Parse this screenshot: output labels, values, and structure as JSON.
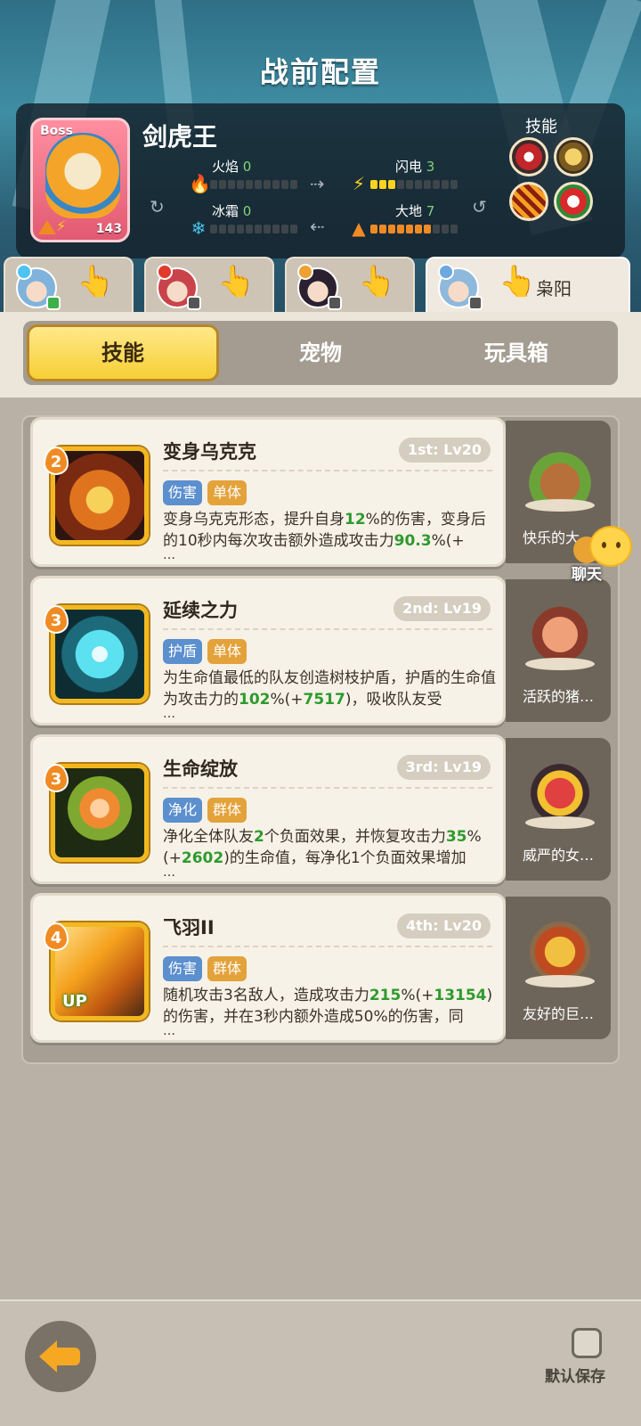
{
  "header": {
    "title": "战前配置"
  },
  "boss": {
    "tag": "Boss",
    "name": "剑虎王",
    "level": "143",
    "elements": [
      {
        "label": "火焰",
        "value": "0",
        "icon": "fire-icon",
        "filled": 0,
        "color": "#e23b2b"
      },
      {
        "label": "闪电",
        "value": "3",
        "icon": "lightning-icon",
        "filled": 3,
        "color": "#ffd21f"
      },
      {
        "label": "冰霜",
        "value": "0",
        "icon": "snowflake-icon",
        "filled": 0,
        "color": "#4cc3f0"
      },
      {
        "label": "大地",
        "value": "7",
        "icon": "mountain-icon",
        "filled": 7,
        "color": "#f08b24"
      }
    ],
    "skills_label": "技能",
    "skill_icons": [
      "boss-skill-bite-icon",
      "boss-skill-roar-icon",
      "boss-skill-slash-icon",
      "boss-skill-claw-icon"
    ]
  },
  "heroes": [
    {
      "name": "",
      "active": false,
      "badge": "green"
    },
    {
      "name": "",
      "active": false,
      "badge": "gray"
    },
    {
      "name": "",
      "active": false,
      "badge": "gray"
    },
    {
      "name": "枭阳",
      "active": true,
      "badge": "gray"
    }
  ],
  "tabs": [
    "技能",
    "宠物",
    "玩具箱"
  ],
  "skills": [
    {
      "order": "2",
      "name": "变身乌克克",
      "level": "1st: Lv20",
      "tags": [
        {
          "text": "伤害",
          "kind": "blue"
        },
        {
          "text": "单体",
          "kind": "orange"
        }
      ],
      "desc": [
        {
          "t": "变身乌克克形态，提升自身"
        },
        {
          "t": "12",
          "g": true
        },
        {
          "t": "%的伤害，变身后的10秒内每次攻击额外造成攻击力"
        },
        {
          "t": "90.3",
          "g": true
        },
        {
          "t": "%(+"
        }
      ],
      "ellipsis": "…",
      "pet": "快乐的大…",
      "up": ""
    },
    {
      "order": "3",
      "name": "延续之力",
      "level": "2nd: Lv19",
      "tags": [
        {
          "text": "护盾",
          "kind": "blue"
        },
        {
          "text": "单体",
          "kind": "orange"
        }
      ],
      "desc": [
        {
          "t": "为生命值最低的队友创造树枝护盾，护盾的生命值为攻击力的"
        },
        {
          "t": "102",
          "g": true
        },
        {
          "t": "%(+"
        },
        {
          "t": "7517",
          "g": true
        },
        {
          "t": ")，吸收队友受"
        }
      ],
      "ellipsis": "…",
      "pet": "活跃的猪…",
      "up": ""
    },
    {
      "order": "3",
      "name": "生命绽放",
      "level": "3rd: Lv19",
      "tags": [
        {
          "text": "净化",
          "kind": "blue"
        },
        {
          "text": "群体",
          "kind": "orange"
        }
      ],
      "desc": [
        {
          "t": "净化全体队友"
        },
        {
          "t": "2",
          "g": true
        },
        {
          "t": "个负面效果，并恢复攻击力"
        },
        {
          "t": "35",
          "g": true
        },
        {
          "t": "%(+"
        },
        {
          "t": "2602",
          "g": true
        },
        {
          "t": ")的生命值，每净化1个负面效果增加"
        }
      ],
      "ellipsis": "…",
      "pet": "威严的女…",
      "up": ""
    },
    {
      "order": "4",
      "name": "飞羽II",
      "level": "4th: Lv20",
      "tags": [
        {
          "text": "伤害",
          "kind": "blue"
        },
        {
          "text": "群体",
          "kind": "orange"
        }
      ],
      "desc": [
        {
          "t": "随机攻击3名敌人，造成攻击力"
        },
        {
          "t": "215",
          "g": true
        },
        {
          "t": "%(+"
        },
        {
          "t": "13154",
          "g": true
        },
        {
          "t": ")的伤害，并在3秒内额外造成50%的伤害，同"
        }
      ],
      "ellipsis": "…",
      "pet": "友好的巨…",
      "up": "UP"
    }
  ],
  "chat": {
    "label": "聊天"
  },
  "footer": {
    "save_label": "默认保存"
  }
}
